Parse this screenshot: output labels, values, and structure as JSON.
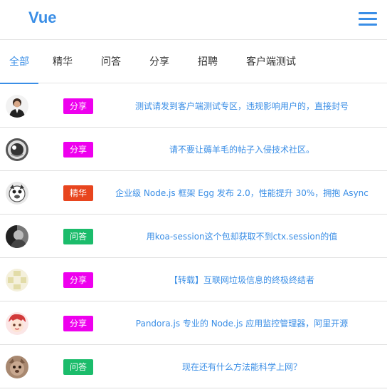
{
  "header": {
    "brand": "Vue",
    "menu_icon": "hamburger-menu-icon"
  },
  "tabs": [
    {
      "label": "全部",
      "active": true
    },
    {
      "label": "精华",
      "active": false
    },
    {
      "label": "问答",
      "active": false
    },
    {
      "label": "分享",
      "active": false
    },
    {
      "label": "招聘",
      "active": false
    },
    {
      "label": "客户端测试",
      "active": false
    }
  ],
  "topics": [
    {
      "badge": "分享",
      "badge_color": "#ee00ee",
      "title": "测试请发到客户端测试专区，违规影响用户的，直接封号"
    },
    {
      "badge": "分享",
      "badge_color": "#ee00ee",
      "title": "请不要让薅羊毛的帖子入侵技术社区。"
    },
    {
      "badge": "精华",
      "badge_color": "#e8451e",
      "title": "企业级 Node.js 框架 Egg 发布 2.0，性能提升 30%，拥抱 Async"
    },
    {
      "badge": "问答",
      "badge_color": "#1bbc6b",
      "title": "用koa-session这个包却获取不到ctx.session的值"
    },
    {
      "badge": "分享",
      "badge_color": "#ee00ee",
      "title": "【转载】互联网垃圾信息的终极终结者"
    },
    {
      "badge": "分享",
      "badge_color": "#ee00ee",
      "title": "Pandora.js 专业的 Node.js 应用监控管理器，阿里开源"
    },
    {
      "badge": "问答",
      "badge_color": "#1bbc6b",
      "title": "现在还有什么方法能科学上网？"
    }
  ],
  "colors": {
    "accent": "#3a8ee6",
    "share": "#ee00ee",
    "good": "#e8451e",
    "ask": "#1bbc6b"
  }
}
